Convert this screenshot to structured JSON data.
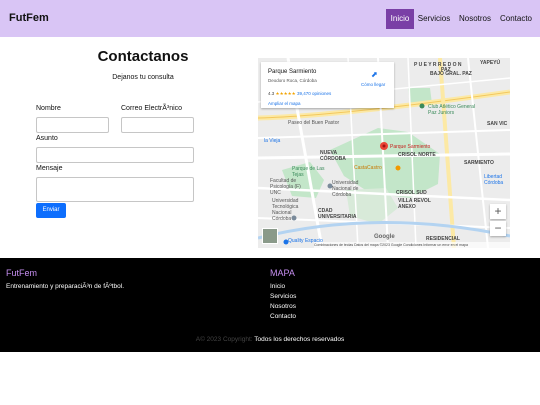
{
  "header": {
    "brand": "FutFem",
    "nav": [
      "Inicio",
      "Servicios",
      "Nosotros",
      "Contacto"
    ],
    "active_color": "#7a3fa6",
    "bg_color": "#d9c5f5"
  },
  "contact": {
    "title": "Contactanos",
    "subtitle": "Dejanos tu consulta",
    "name_label": "Nombre",
    "email_label": "Correo ElectrÃ³nico",
    "subject_label": "Asunto",
    "message_label": "Mensaje",
    "send_label": "Enviar"
  },
  "map": {
    "place_name": "Parque Sarmiento",
    "address": "Deodoro Roca, Córdoba",
    "rating": "4.3",
    "stars": "★★★★★",
    "reviews": "39,470 opiniones",
    "directions": "Cómo llegar",
    "larger_map": "Ampliar el mapa",
    "zoom_in": "+",
    "zoom_out": "−",
    "google": "Google",
    "footer_text": "Combinaciones de teclas   Datos del mapa ©2023 Google   Condiciones   Informar un error en el mapa",
    "labels": {
      "pueyrredon": "P U E Y R R E D O N",
      "paz": "PAZ",
      "yapeyu": "YAPEYÚ",
      "bajo_gral_paz": "BAJO GRAL. PAZ",
      "club": "Club Atlético General Paz Juniors",
      "paseo": "Paseo del Buen Pastor",
      "la_vieja": "la Vieja",
      "nueva_cordoba": "NUEVA CÓRDOBA",
      "parque": "Parque Sarmiento",
      "crisol_norte": "CRISOL NORTE",
      "san_vicente": "SAN VIC",
      "sarmiento": "SARMIENTO",
      "parque_tejas": "Parque de Las Tejas",
      "castacastro": "CastaCastro",
      "facultad": "Facultad de Psicología (F) UNC",
      "universidad_nacional": "Universidad Nacional de Córdoba",
      "crisol_sud": "CRISOL SUD",
      "villa_revol": "VILLA REVOL ANEXO",
      "libertad": "Libertad Córdoba",
      "utn": "Universidad Tecnológica Nacional Córdoba",
      "ciudad_universitaria": "CDAD UNIVERSITARIA",
      "quality": "Quality Espacio",
      "residencial": "RESIDENCIAL"
    }
  },
  "footer": {
    "brand": "FutFem",
    "description": "Entrenamiento y preparaciÃ³n de fÃºtbol.",
    "map_title": "MAPA",
    "links": [
      "Inicio",
      "Servicios",
      "Nosotros",
      "Contacto"
    ],
    "copyright": "A© 2023 Copyright:",
    "rights": "Todos los derechos reservados"
  }
}
